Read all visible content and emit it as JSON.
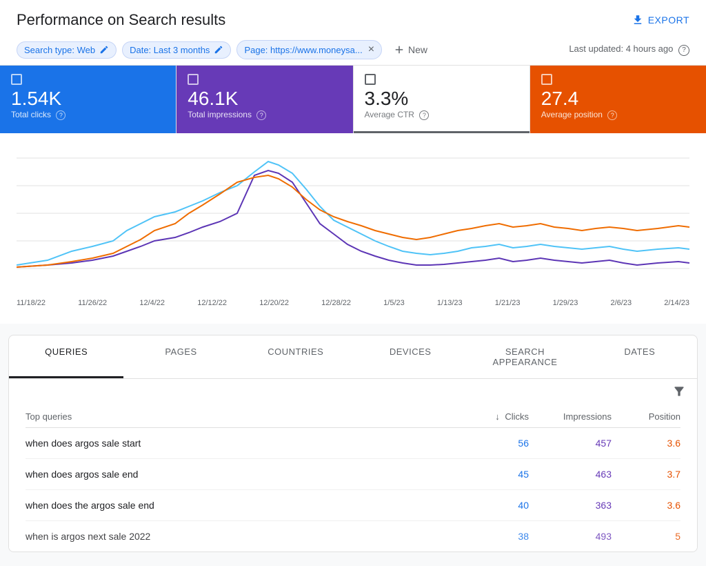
{
  "header": {
    "title": "Performance on Search results",
    "export_label": "EXPORT"
  },
  "filters": {
    "chips": [
      {
        "label": "Search type: Web",
        "editable": true
      },
      {
        "label": "Date: Last 3 months",
        "editable": true
      },
      {
        "label": "Page: https://www.moneysa...",
        "closable": true
      }
    ],
    "add_label": "New",
    "last_updated": "Last updated: 4 hours ago"
  },
  "metrics": [
    {
      "id": "clicks",
      "value": "1.54K",
      "label": "Total clicks",
      "active": "blue"
    },
    {
      "id": "impressions",
      "value": "46.1K",
      "label": "Total impressions",
      "active": "purple"
    },
    {
      "id": "ctr",
      "value": "3.3%",
      "label": "Average CTR",
      "active": "white"
    },
    {
      "id": "position",
      "value": "27.4",
      "label": "Average position",
      "active": "orange"
    }
  ],
  "xaxis_labels": [
    "11/18/22",
    "11/26/22",
    "12/4/22",
    "12/12/22",
    "12/20/22",
    "12/28/22",
    "1/5/23",
    "1/13/23",
    "1/21/23",
    "1/29/23",
    "2/6/23",
    "2/14/23"
  ],
  "tabs": [
    {
      "id": "queries",
      "label": "QUERIES",
      "active": true
    },
    {
      "id": "pages",
      "label": "PAGES",
      "active": false
    },
    {
      "id": "countries",
      "label": "COUNTRIES",
      "active": false
    },
    {
      "id": "devices",
      "label": "DEVICES",
      "active": false
    },
    {
      "id": "search-appearance",
      "label": "SEARCH APPEARANCE",
      "active": false
    },
    {
      "id": "dates",
      "label": "DATES",
      "active": false
    }
  ],
  "table": {
    "columns": [
      {
        "id": "query",
        "label": "Top queries"
      },
      {
        "id": "clicks",
        "label": "Clicks",
        "sorted": true
      },
      {
        "id": "impressions",
        "label": "Impressions"
      },
      {
        "id": "position",
        "label": "Position"
      }
    ],
    "rows": [
      {
        "query": "when does argos sale start",
        "clicks": "56",
        "impressions": "457",
        "position": "3.6"
      },
      {
        "query": "when does argos sale end",
        "clicks": "45",
        "impressions": "463",
        "position": "3.7"
      },
      {
        "query": "when does the argos sale end",
        "clicks": "40",
        "impressions": "363",
        "position": "3.6"
      },
      {
        "query": "when is argos next sale 2022",
        "clicks": "38",
        "impressions": "493",
        "position": "5"
      }
    ]
  },
  "colors": {
    "blue": "#1a73e8",
    "purple": "#673ab7",
    "orange": "#e65100",
    "chart_blue": "#4fc3f7",
    "chart_purple": "#5c35b5",
    "chart_orange": "#ef6c00"
  }
}
